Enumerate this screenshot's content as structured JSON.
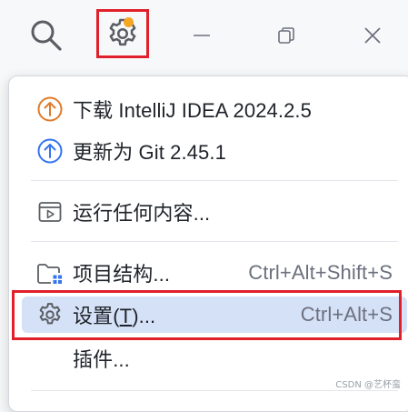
{
  "titlebar": {
    "search_icon": "search-icon",
    "settings_icon": "gear-icon",
    "notification_color": "#f5a623",
    "minimize_icon": "minimize-icon",
    "restore_icon": "restore-icon",
    "close_icon": "close-icon"
  },
  "menu": {
    "items": [
      {
        "label": "下载 IntelliJ IDEA 2024.2.5",
        "icon": "download-update-icon",
        "icon_color": "#e07b2a"
      },
      {
        "label": "更新为 Git 2.45.1",
        "icon": "update-git-icon",
        "icon_color": "#3574f0"
      },
      {
        "label": "运行任何内容...",
        "icon": "run-anything-icon"
      },
      {
        "label": "项目结构...",
        "shortcut": "Ctrl+Alt+Shift+S",
        "icon": "project-structure-icon"
      },
      {
        "label_prefix": "设置(",
        "label_mnemonic": "T",
        "label_suffix": ")...",
        "shortcut": "Ctrl+Alt+S",
        "icon": "gear-icon",
        "selected": true
      },
      {
        "label": "插件..."
      }
    ]
  },
  "colors": {
    "highlight_border": "#e0202a",
    "selected_bg": "#d5e1f7"
  },
  "watermark": "CSDN @艺杯蛮"
}
